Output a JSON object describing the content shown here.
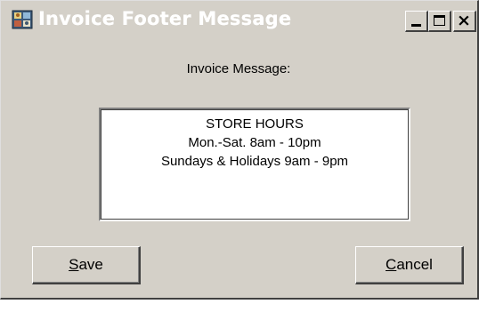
{
  "window": {
    "title": "Invoice Footer Message"
  },
  "title_buttons": {
    "minimize_icon": "minimize-icon",
    "maximize_icon": "maximize-icon",
    "close_icon": "close-icon",
    "close_glyph": "×"
  },
  "form": {
    "message_label": "Invoice Message:",
    "message_lines": [
      "STORE HOURS",
      "Mon.-Sat. 8am - 10pm",
      "Sundays & Holidays 9am - 9pm"
    ]
  },
  "buttons": {
    "save": {
      "mnemonic": "S",
      "rest": "ave"
    },
    "cancel": {
      "mnemonic": "C",
      "rest": "ancel"
    }
  },
  "colors": {
    "face": "#d4d0c8",
    "memo_background": "#ffffff",
    "text": "#000000"
  }
}
